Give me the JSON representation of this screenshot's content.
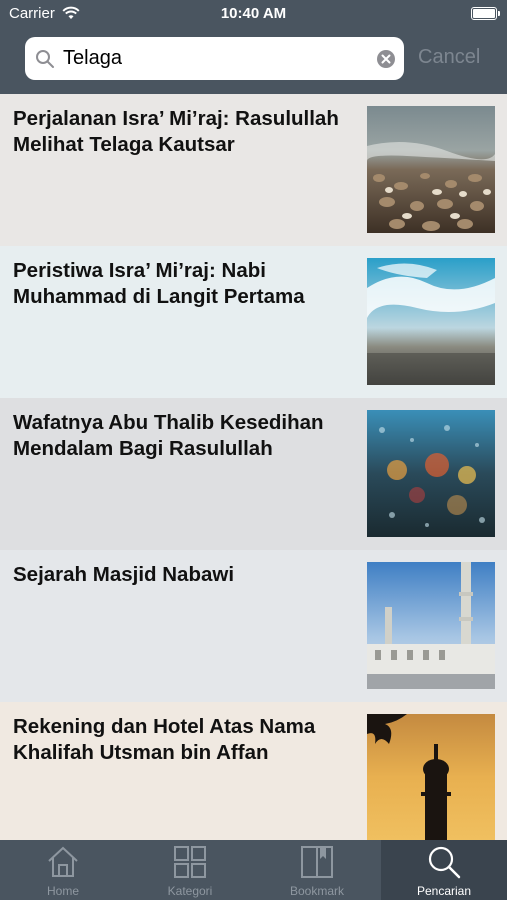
{
  "status_bar": {
    "carrier": "Carrier",
    "time": "10:40 AM"
  },
  "search": {
    "value": "Telaga",
    "cancel_label": "Cancel"
  },
  "articles": [
    {
      "title": "Perjalanan Isra’ Mi’raj: Rasulullah Melihat Telaga Kautsar",
      "image": "beach-pebbles"
    },
    {
      "title": "Peristiwa Isra’ Mi’raj: Nabi Muhammad di Langit Pertama",
      "image": "sky-clouds"
    },
    {
      "title": "Wafatnya Abu Thalib Kesedihan Mendalam Bagi Rasulullah",
      "image": "rainy-window"
    },
    {
      "title": "Sejarah Masjid Nabawi",
      "image": "mosque-minarets"
    },
    {
      "title": "Rekening dan Hotel Atas Nama Khalifah Utsman bin Affan",
      "image": "minaret-sunset"
    }
  ],
  "tabs": [
    {
      "label": "Home",
      "icon": "home-icon",
      "active": false
    },
    {
      "label": "Kategori",
      "icon": "grid-icon",
      "active": false
    },
    {
      "label": "Bookmark",
      "icon": "book-icon",
      "active": false
    },
    {
      "label": "Pencarian",
      "icon": "search-icon",
      "active": true
    }
  ],
  "colors": {
    "nav_bar": "#4a5560",
    "tab_active_bg": "#3a444e",
    "row_backgrounds": [
      "#e9e7e5",
      "#e7eef0",
      "#dedfe1",
      "#e4e7ea",
      "#f0e9e1"
    ]
  }
}
